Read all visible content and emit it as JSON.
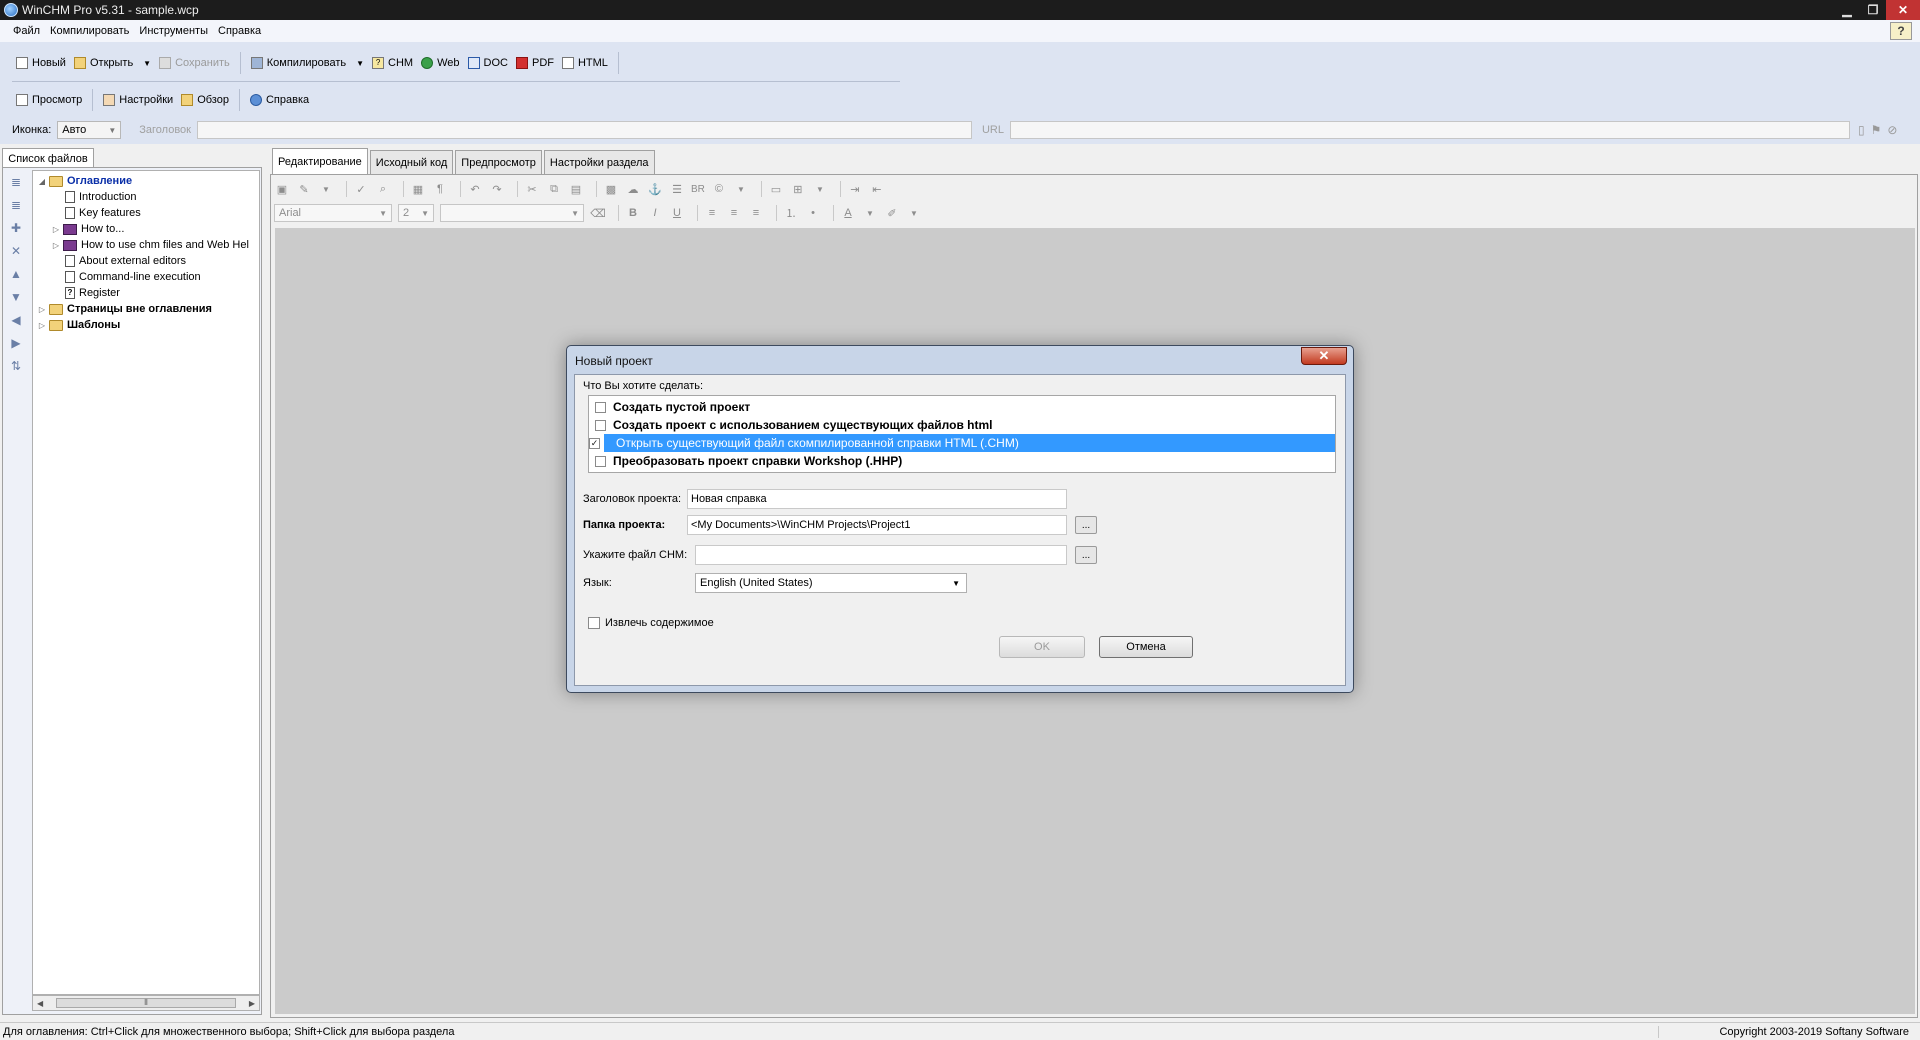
{
  "window": {
    "title": "WinCHM Pro v5.31 - sample.wcp"
  },
  "menu": [
    "Файл",
    "Компилировать",
    "Инструменты",
    "Справка"
  ],
  "toolbar1": {
    "new": "Новый",
    "open": "Открыть",
    "save": "Сохранить",
    "compile": "Компилировать",
    "chm": "CHM",
    "web": "Web",
    "doc": "DOC",
    "pdf": "PDF",
    "html": "HTML"
  },
  "toolbar2": {
    "preview": "Просмотр",
    "settings": "Настройки",
    "browse": "Обзор",
    "help": "Справка"
  },
  "propbar": {
    "icon_label": "Иконка:",
    "icon_value": "Авто",
    "title_label": "Заголовок",
    "url_label": "URL"
  },
  "left_tab": "Список файлов",
  "tree": [
    {
      "label": "Оглавление",
      "level": 0,
      "style": "blue",
      "icon": "folder",
      "exp": "◢"
    },
    {
      "label": "Introduction",
      "level": 1,
      "icon": "page",
      "exp": ""
    },
    {
      "label": "Key features",
      "level": 1,
      "icon": "page",
      "exp": ""
    },
    {
      "label": "How to...",
      "level": 1,
      "icon": "book",
      "exp": "▷"
    },
    {
      "label": "How to use chm files and Web Hel",
      "level": 1,
      "icon": "book",
      "exp": "▷"
    },
    {
      "label": "About external editors",
      "level": 1,
      "icon": "page",
      "exp": ""
    },
    {
      "label": "Command-line execution",
      "level": 1,
      "icon": "page",
      "exp": ""
    },
    {
      "label": "Register",
      "level": 1,
      "icon": "qpage",
      "exp": ""
    },
    {
      "label": "Страницы вне оглавления",
      "level": 0,
      "style": "bold",
      "icon": "folder",
      "exp": "▷"
    },
    {
      "label": "Шаблоны",
      "level": 0,
      "style": "bold",
      "icon": "folder",
      "exp": "▷"
    }
  ],
  "editor_tabs": [
    "Редактирование",
    "Исходный код",
    "Предпросмотр",
    "Настройки раздела"
  ],
  "editor_toolbar": {
    "font": "Arial",
    "size": "2",
    "br": "BR"
  },
  "dialog": {
    "title": "Новый проект",
    "close": "✕",
    "question": "Что Вы хотите сделать:",
    "options": [
      {
        "label": "Создать пустой проект",
        "checked": false,
        "selected": false
      },
      {
        "label": "Создать проект с использованием существующих файлов html",
        "checked": false,
        "selected": false
      },
      {
        "label": "Открыть существующий файл скомпилированной справки HTML (.CHM)",
        "checked": true,
        "selected": true
      },
      {
        "label": "Преобразовать проект справки Workshop (.HHP)",
        "checked": false,
        "selected": false
      }
    ],
    "project_title_label": "Заголовок проекта:",
    "project_title_value": "Новая справка",
    "project_folder_label": "Папка проекта:",
    "project_folder_value": "<My Documents>\\WinCHM Projects\\Project1",
    "chm_label": "Укажите файл CHM:",
    "chm_value": "",
    "browse": "...",
    "language_label": "Язык:",
    "language_value": "English (United States)",
    "extract_label": "Извлечь содержимое",
    "extract_checked": false,
    "ok": "OK",
    "cancel": "Отмена"
  },
  "status": {
    "left": "Для оглавления: Ctrl+Click для множественного выбора; Shift+Click для выбора раздела",
    "right": "Copyright 2003-2019 Softany Software"
  }
}
